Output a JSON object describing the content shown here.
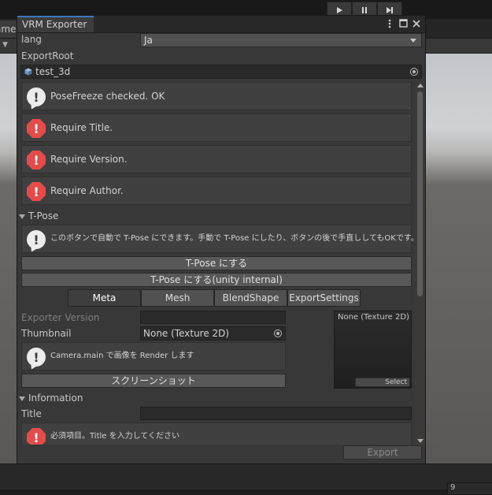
{
  "background": {
    "left_tab_fragment": "ame",
    "bottom_field_value": "9",
    "toolbar_icons": [
      "play-icon",
      "pause-icon",
      "step-icon"
    ]
  },
  "window": {
    "title": "VRM Exporter",
    "title_icons": [
      "more-icon",
      "maximize-icon",
      "close-icon"
    ]
  },
  "header": {
    "lang_label": "lang",
    "lang_value": "Ja",
    "export_root_label": "ExportRoot",
    "export_root_value": "test_3d"
  },
  "messages": [
    {
      "type": "info",
      "icon": "info-speech-icon",
      "text": "PoseFreeze checked. OK"
    },
    {
      "type": "error",
      "icon": "error-icon",
      "text": "Require Title."
    },
    {
      "type": "error",
      "icon": "error-icon",
      "text": "Require Version."
    },
    {
      "type": "error",
      "icon": "error-icon",
      "text": "Require Author."
    }
  ],
  "tpose": {
    "foldout_label": "T-Pose",
    "help_text": "このボタンで自動で T-Pose にできます。手動で T-Pose にしたり、ボタンの後で手直ししてもOKです。",
    "button1": "T-Pose にする",
    "button2": "T-Pose にする(unity internal)"
  },
  "tabs": [
    {
      "label": "Meta",
      "active": true
    },
    {
      "label": "Mesh",
      "active": false
    },
    {
      "label": "BlendShape",
      "active": false
    },
    {
      "label": "ExportSettings",
      "active": false
    }
  ],
  "meta": {
    "exporter_version_label": "Exporter Version",
    "exporter_version_value": "",
    "thumbnail_label": "Thumbnail",
    "thumbnail_value": "None (Texture 2D)",
    "thumbnail_help": "Camera.main で画像を Render します",
    "screenshot_button": "スクリーンショット",
    "preview_title": "None (Texture 2D)",
    "preview_select": "Select"
  },
  "information": {
    "foldout_label": "Information",
    "title_label": "Title",
    "title_value": "",
    "title_error": "必須項目。Title を入力してください"
  },
  "footer": {
    "export_button": "Export"
  },
  "colors": {
    "error": "#e54b4b",
    "accent": "#3a79bb"
  }
}
